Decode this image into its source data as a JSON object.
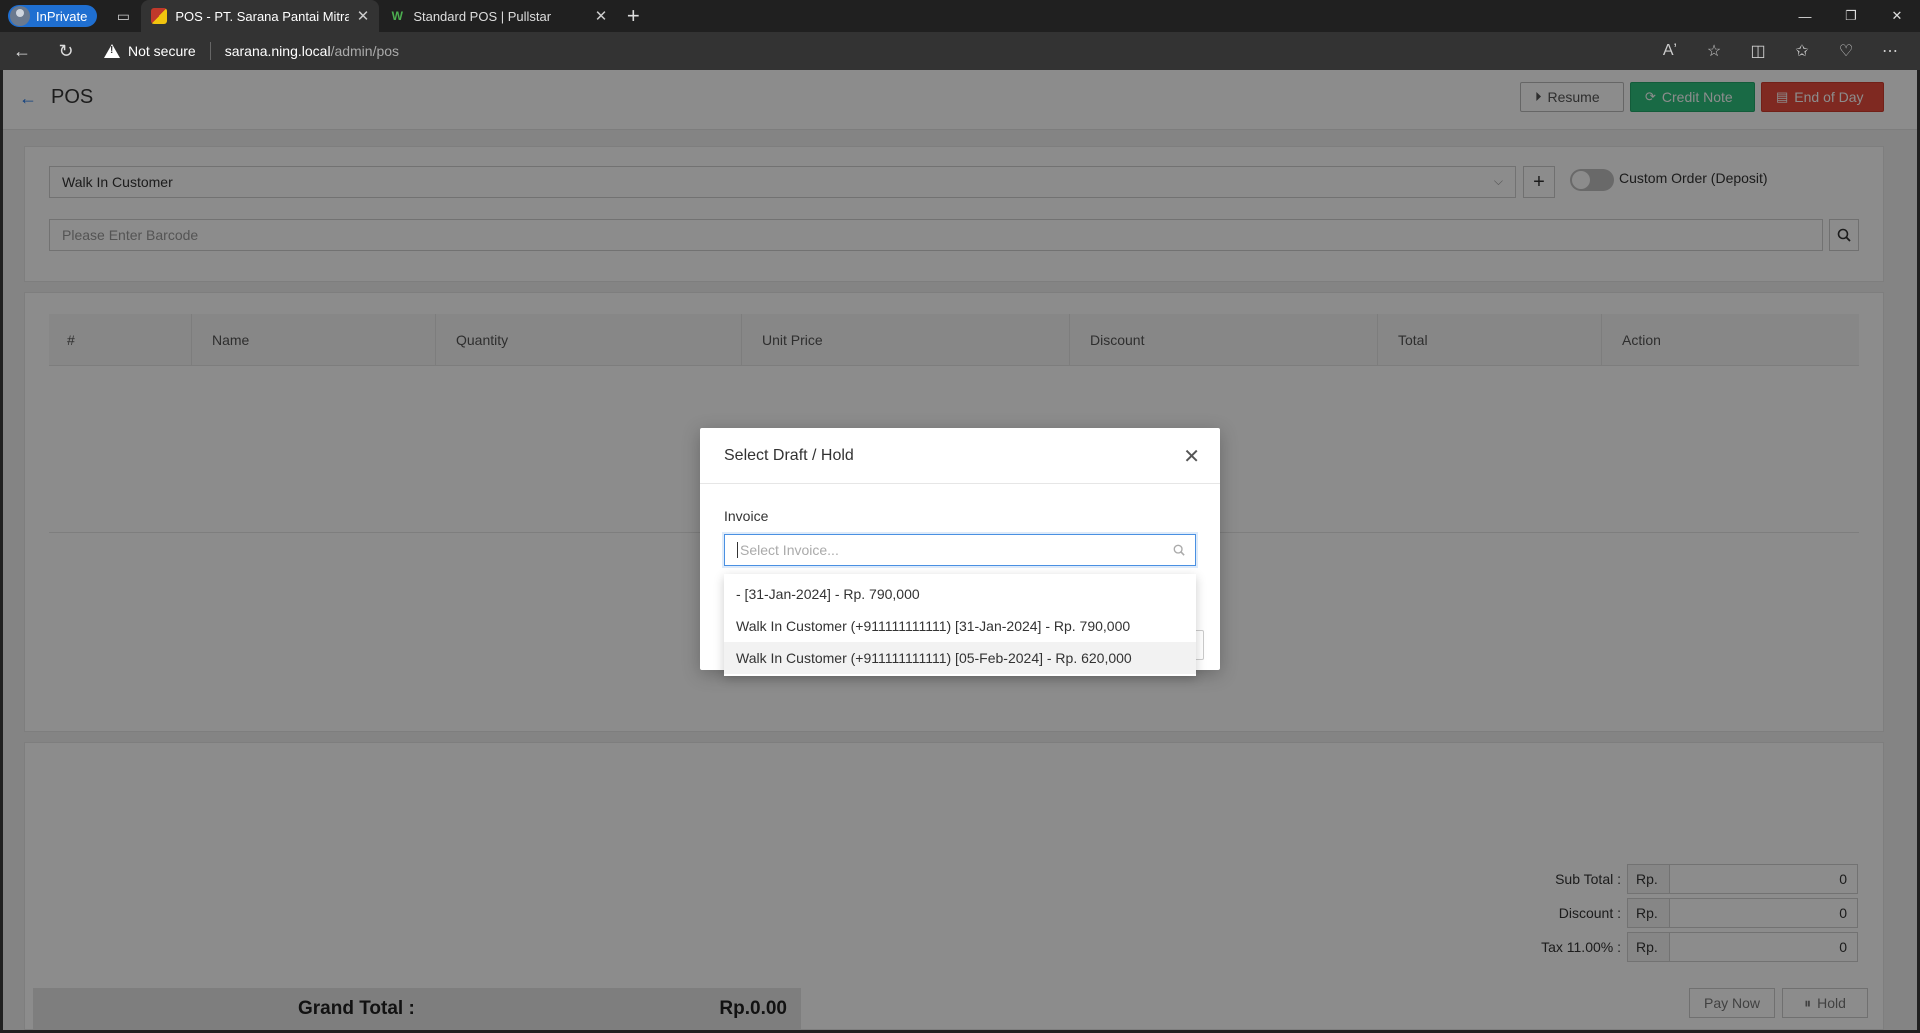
{
  "browser": {
    "inprivate_label": "InPrivate",
    "tabs": [
      {
        "title": "POS - PT. Sarana Pantai Mitra Se",
        "active": true
      },
      {
        "title": "Standard POS | Pullstar",
        "active": false
      }
    ],
    "security_label": "Not secure",
    "url_host": "sarana.ning.local",
    "url_path": "/admin/pos"
  },
  "header": {
    "title": "POS",
    "resume_label": "Resume",
    "credit_note_label": "Credit Note",
    "end_of_day_label": "End of Day"
  },
  "customer": {
    "selected": "Walk In Customer",
    "custom_order_label": "Custom Order (Deposit)",
    "custom_order_enabled": false
  },
  "barcode": {
    "placeholder": "Please Enter Barcode"
  },
  "table": {
    "columns": [
      "#",
      "Name",
      "Quantity",
      "Unit Price",
      "Discount",
      "Total",
      "Action"
    ]
  },
  "summary": {
    "sub_total_label": "Sub Total :",
    "discount_label": "Discount :",
    "tax_label": "Tax 11.00% :",
    "currency_prefix": "Rp.",
    "sub_total_value": "0",
    "discount_value": "0",
    "tax_value": "0",
    "grand_total_label": "Grand Total :",
    "grand_total_value": "Rp.0.00",
    "pay_now_label": "Pay Now",
    "hold_label": "Hold"
  },
  "modal": {
    "title": "Select Draft / Hold",
    "field_label": "Invoice",
    "placeholder": "Select Invoice...",
    "options": [
      "- [31-Jan-2024] - Rp. 790,000",
      "Walk In Customer (+911111111111) [31-Jan-2024] - Rp. 790,000",
      "Walk In Customer (+911111111111) [05-Feb-2024] - Rp. 620,000"
    ]
  },
  "colors": {
    "credit_note": "#2ec27e",
    "end_of_day": "#e74c3c",
    "inprivate": "#1f6fd1",
    "focus": "#4a90e2"
  }
}
